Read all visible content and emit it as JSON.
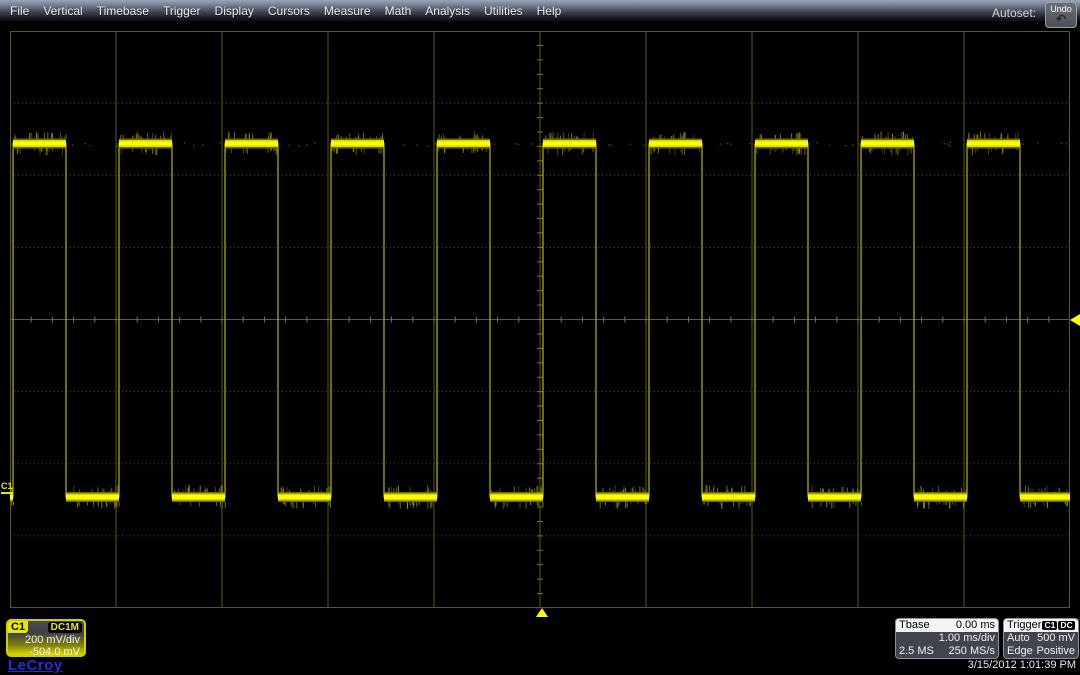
{
  "menu": {
    "items": [
      "File",
      "Vertical",
      "Timebase",
      "Trigger",
      "Display",
      "Cursors",
      "Measure",
      "Math",
      "Analysis",
      "Utilities",
      "Help"
    ],
    "autoset_label": "Autoset:",
    "undo_label": "Undo"
  },
  "channel": {
    "name": "C1",
    "coupling": "DC1M",
    "scale": "200 mV/div",
    "offset": "-504.0 mV"
  },
  "logo": "LeCroy",
  "timebase": {
    "label": "Tbase",
    "position": "0.00 ms",
    "scale": "1.00 ms/div",
    "samples": "2.5 MS",
    "rate": "250 MS/s"
  },
  "trigger": {
    "label": "Trigger",
    "source": "C1",
    "coupling": "DC",
    "mode": "Auto",
    "level": "500 mV",
    "type": "Edge",
    "slope": "Positive"
  },
  "timestamp": "3/15/2012 1:01:39 PM",
  "grid": {
    "h_divisions": 10,
    "v_divisions": 8
  },
  "waveform": {
    "channel": "C1",
    "shape": "square",
    "period_ms": 1.0,
    "duty_cycle": 0.5,
    "high_level_mv": 500,
    "low_level_mv": -500,
    "color": "#ffff00"
  },
  "colors": {
    "trace": "#ffff00",
    "grid_line": "#5c5c00",
    "center_line": "#5a5a5a",
    "marker": "#ffff00"
  }
}
